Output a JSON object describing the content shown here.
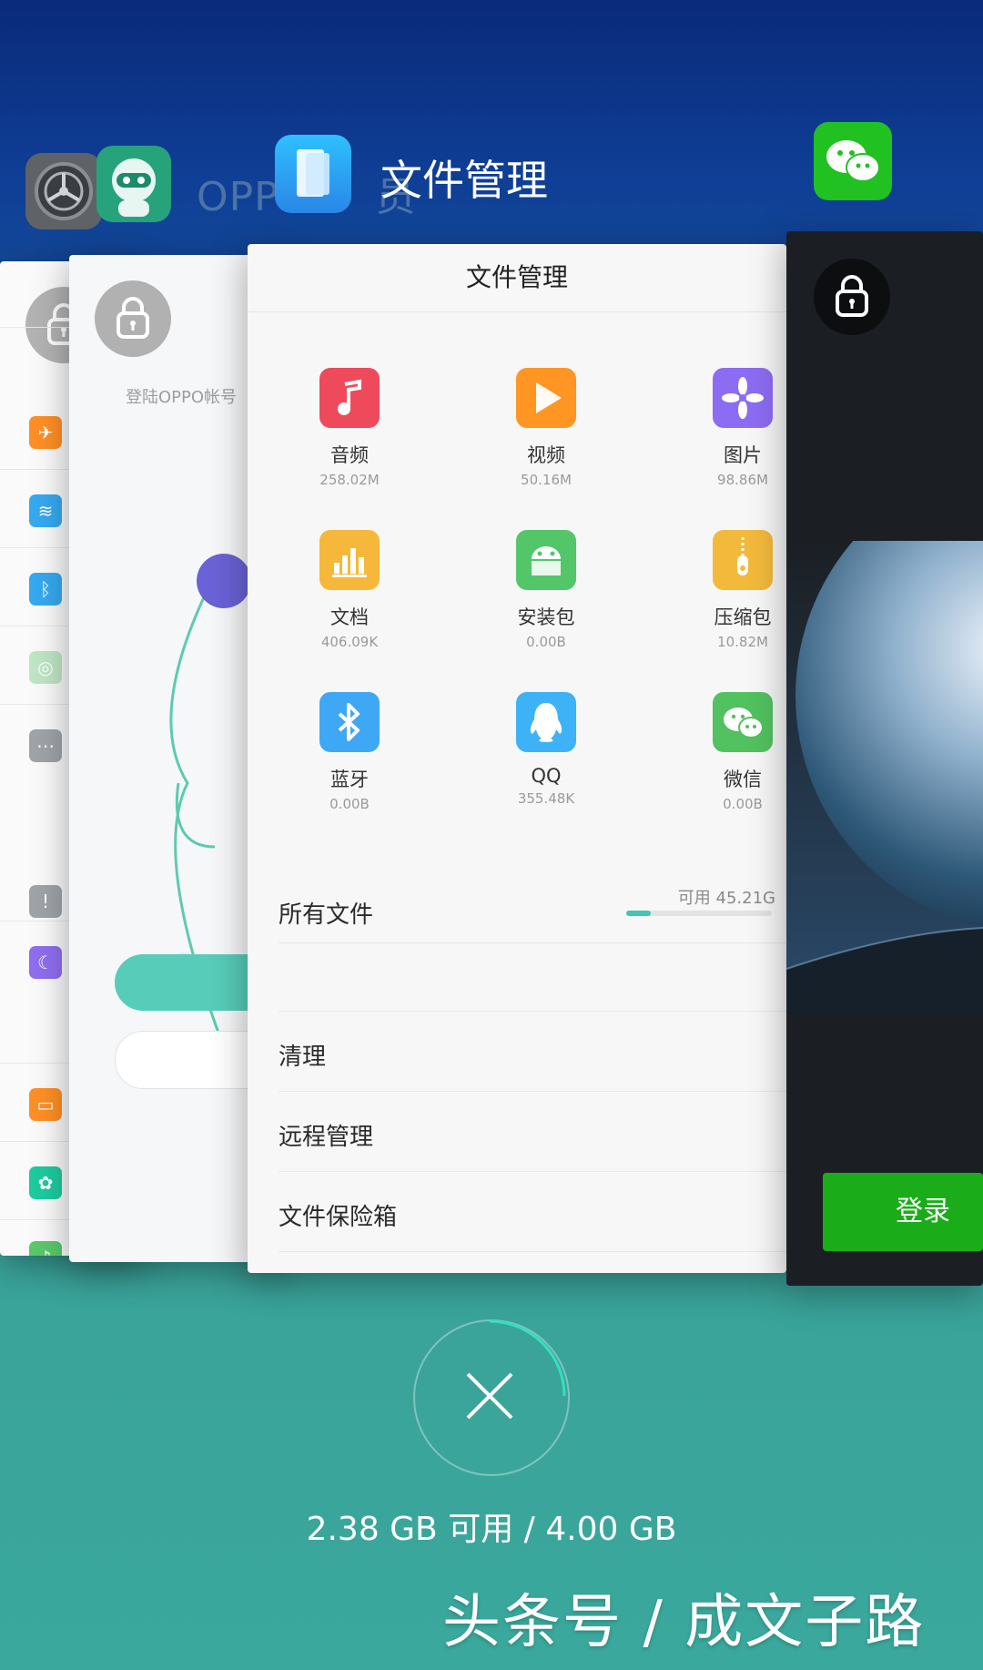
{
  "recents": {
    "apps": [
      {
        "id": "settings",
        "label": ""
      },
      {
        "id": "oppo-account",
        "label": "OPPO",
        "label_suffix": "员"
      },
      {
        "id": "file-manager",
        "label": "文件管理"
      },
      {
        "id": "wechat",
        "label": ""
      }
    ],
    "oppo_card": {
      "login_hint": "登陆OPPO帐号"
    },
    "file_manager": {
      "title": "文件管理",
      "categories": [
        {
          "name": "音频",
          "size": "258.02M",
          "icon": "music-icon",
          "color": "#ee4a5c"
        },
        {
          "name": "视频",
          "size": "50.16M",
          "icon": "video-play-icon",
          "color": "#ff9522"
        },
        {
          "name": "图片",
          "size": "98.86M",
          "icon": "flower-icon",
          "color": "#8c6cf2"
        },
        {
          "name": "文档",
          "size": "406.09K",
          "icon": "bar-chart-icon",
          "color": "#f5b83a"
        },
        {
          "name": "安装包",
          "size": "0.00B",
          "icon": "android-icon",
          "color": "#53c66a"
        },
        {
          "name": "压缩包",
          "size": "10.82M",
          "icon": "zipper-icon",
          "color": "#f2b93b"
        },
        {
          "name": "蓝牙",
          "size": "0.00B",
          "icon": "bluetooth-icon",
          "color": "#3fa8f5"
        },
        {
          "name": "QQ",
          "size": "355.48K",
          "icon": "qq-penguin-icon",
          "color": "#3db2f6"
        },
        {
          "name": "微信",
          "size": "0.00B",
          "icon": "wechat-icon",
          "color": "#52c15f"
        }
      ],
      "all_files": "所有文件",
      "storage_available": "可用 45.21G",
      "storage_used_fraction": 0.17,
      "menu": [
        "清理",
        "远程管理",
        "文件保险箱"
      ]
    },
    "wechat_card": {
      "login": "登录"
    },
    "memory": "2.38 GB 可用 / 4.00 GB",
    "watermark": "头条号 / 成文子路"
  }
}
